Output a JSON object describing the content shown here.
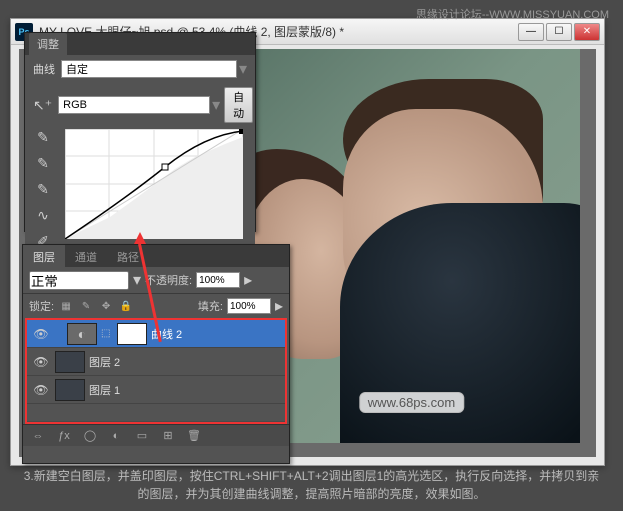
{
  "watermark_top": "思缘设计论坛--WWW.MISSYUAN.COM",
  "window": {
    "title": "MY LOVE   大眼仔~旭.psd @ 53.4% (曲线 2, 图层蒙版/8) *",
    "ps_icon_label": "Ps",
    "btn_min": "—",
    "btn_max": "☐",
    "btn_close": "✕"
  },
  "adjustments": {
    "tab_label": "调整",
    "curve_label": "曲线",
    "preset": "自定",
    "channel": "RGB",
    "auto_btn": "自动"
  },
  "layers": {
    "tabs": [
      "图层",
      "通道",
      "路径"
    ],
    "blend_mode": "正常",
    "opacity_label": "不透明度:",
    "opacity_value": "100%",
    "lock_label": "锁定:",
    "fill_label": "填充:",
    "fill_value": "100%",
    "items": [
      {
        "name": "曲线 2"
      },
      {
        "name": "图层 2"
      },
      {
        "name": "图层 1"
      }
    ]
  },
  "canvas": {
    "url_watermark": "www.68ps.com"
  },
  "caption": "3.新建空白图层，并盖印图层，按住CTRL+SHIFT+ALT+2调出图层1的高光选区，执行反向选择，并拷贝到亲的图层，并为其创建曲线调整，提高照片暗部的亮度，效果如图。"
}
